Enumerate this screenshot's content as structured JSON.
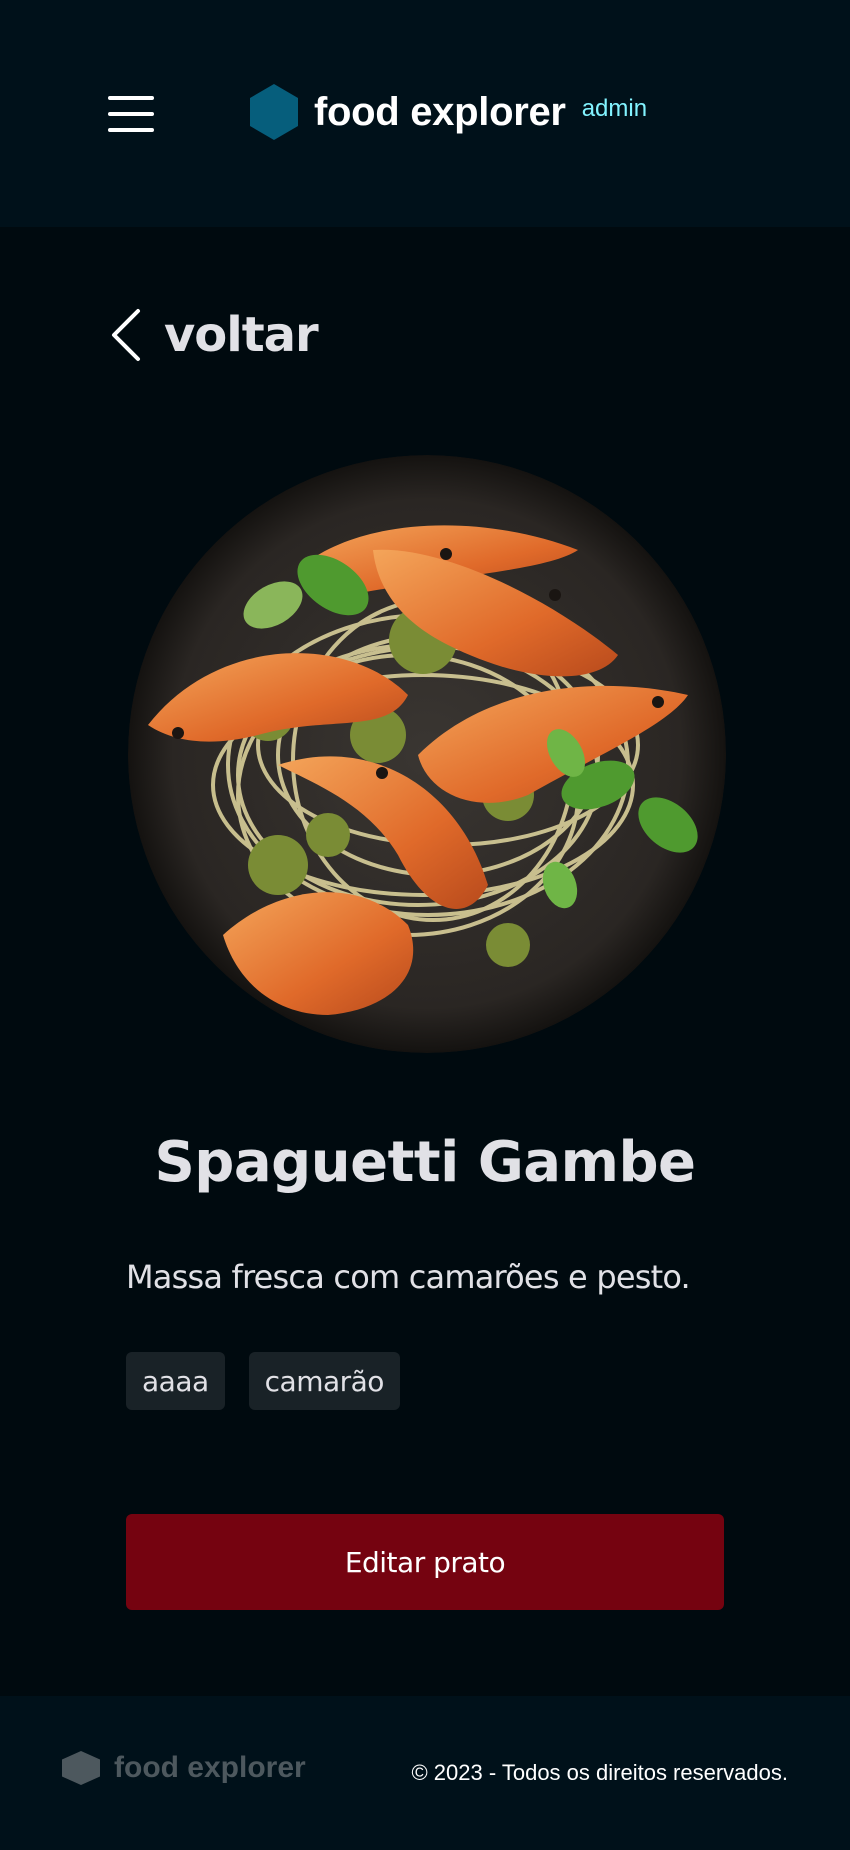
{
  "header": {
    "brand_name": "food explorer",
    "brand_role": "admin",
    "menu_icon": "hamburger-icon",
    "logo_icon": "hexagon-logo-icon",
    "logo_color": "#065e7c",
    "role_color": "#82f3ff"
  },
  "navigation": {
    "back_label": "voltar",
    "back_icon": "chevron-left-icon"
  },
  "dish": {
    "title": "Spaguetti Gambe",
    "description": "Massa fresca com camarões e pesto.",
    "ingredients": [
      "aaaa",
      "camarão"
    ]
  },
  "actions": {
    "edit_label": "Editar prato",
    "edit_color": "#750310"
  },
  "footer": {
    "brand_name": "food explorer",
    "logo_icon": "hexagon-logo-icon",
    "copyright": "© 2023 - Todos os direitos reservados."
  }
}
